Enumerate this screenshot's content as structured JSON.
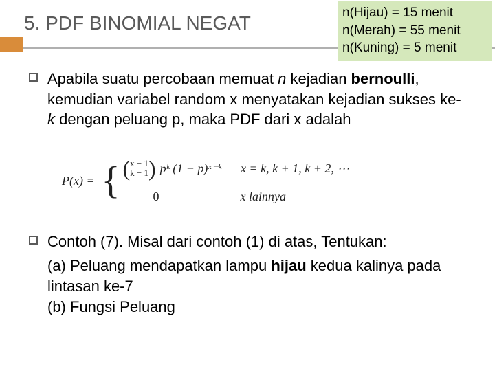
{
  "header": {
    "title": "5. PDF BINOMIAL NEGAT"
  },
  "note": {
    "line1": "n(Hijau) = 15 menit",
    "line2": "n(Merah) = 55 menit",
    "line3": "n(Kuning) = 5 menit"
  },
  "bullets": [
    {
      "text_parts": {
        "p1": "Apabila suatu percobaan memuat ",
        "italic_n": "n",
        "p2": " kejadian ",
        "bold1": "bernoulli",
        "p3": ", kemudian variabel random x menyatakan kejadian sukses ke-",
        "italic_k": "k",
        "p4": " dengan peluang p, maka PDF dari x adalah"
      }
    },
    {
      "text_parts": {
        "p1": "Contoh (7). Misal dari contoh (1) di atas, Tentukan:",
        "sub_a": "(a) Peluang mendapatkan lampu ",
        "bold_hijau": "hijau",
        "sub_a2": " kedua kalinya pada lintasan ke-7",
        "sub_b": "(b) Fungsi Peluang"
      }
    }
  ],
  "formula": {
    "px": "P(x) =",
    "binom_top": "x − 1",
    "binom_bot": "k − 1",
    "expr": "pᵏ (1 − p)ˣ⁻ᵏ",
    "cond1": "x = k, k + 1, k + 2, ⋯",
    "zero": "0",
    "cond2": "x  lainnya"
  }
}
